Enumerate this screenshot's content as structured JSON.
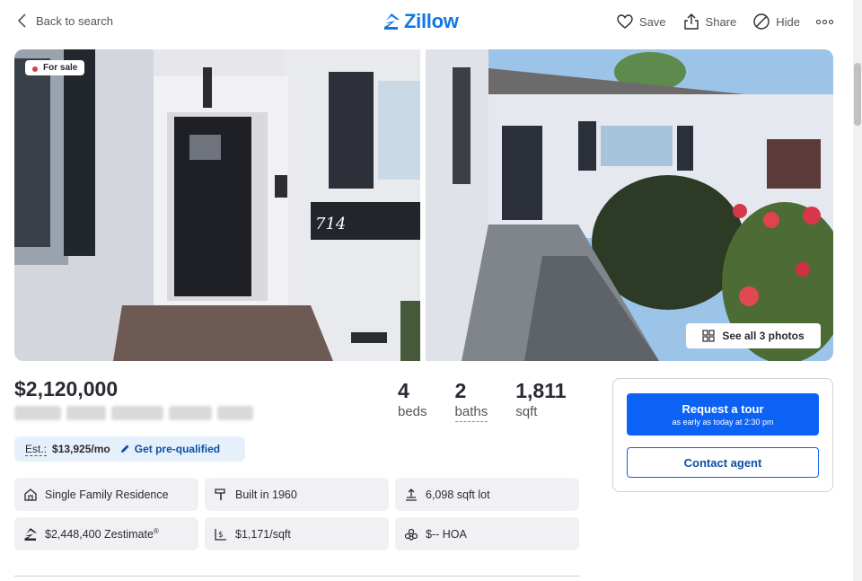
{
  "header": {
    "back_label": "Back to search",
    "logo_text": "Zillow",
    "actions": {
      "save_label": "Save",
      "share_label": "Share",
      "hide_label": "Hide"
    }
  },
  "gallery": {
    "status_badge": "For sale",
    "see_all_label": "See all 3 photos",
    "house_number": "714"
  },
  "listing": {
    "price": "$2,120,000",
    "beds_value": "4",
    "beds_label": "beds",
    "baths_value": "2",
    "baths_label": "baths",
    "sqft_value": "1,811",
    "sqft_label": "sqft",
    "estimate_label": "Est.:",
    "estimate_value": "$13,925/mo",
    "prequalify_label": "Get pre-qualified"
  },
  "facts": [
    {
      "icon": "house-icon",
      "text": "Single Family Residence"
    },
    {
      "icon": "hammer-icon",
      "text": "Built in 1960"
    },
    {
      "icon": "lot-icon",
      "text": "6,098 sqft lot"
    },
    {
      "icon": "zestimate-icon",
      "text": "$2,448,400 Zestimate"
    },
    {
      "icon": "price-per-sqft-icon",
      "text": "$1,171/sqft"
    },
    {
      "icon": "hoa-icon",
      "text": "$-- HOA"
    }
  ],
  "zestimate_mark": "®",
  "agent_card": {
    "tour_label": "Request a tour",
    "tour_sub": "as early as today at 2:30 pm",
    "contact_label": "Contact agent"
  },
  "colors": {
    "brand": "#1277e1",
    "primary_button": "#0d62f6",
    "sale_dot": "#d7423d"
  }
}
